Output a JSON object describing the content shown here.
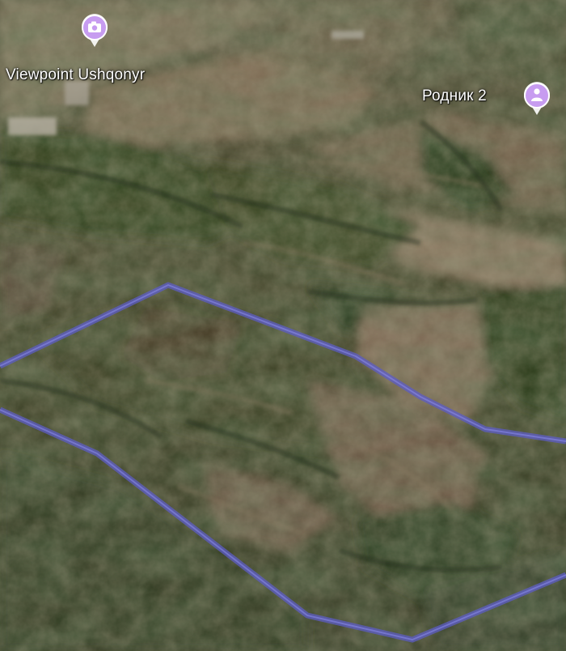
{
  "map": {
    "view": "satellite-3d-terrain",
    "boundary_color": "#6666c8",
    "pins": [
      {
        "name": "Viewpoint Ushqonyr",
        "icon": "camera-icon",
        "pin_color": "#c79cf0"
      },
      {
        "name": "Родник 2",
        "icon": "person-icon",
        "pin_color": "#c79cf0"
      }
    ]
  }
}
